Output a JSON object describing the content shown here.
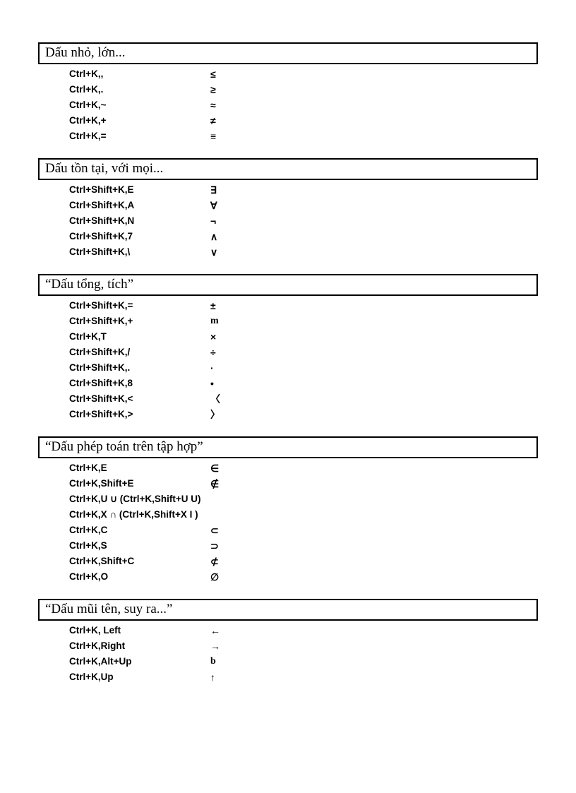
{
  "sections": [
    {
      "title": "Dấu nhỏ, lớn...",
      "rows": [
        {
          "shortcut": "Ctrl+K,,",
          "symbol": "≤"
        },
        {
          "shortcut": "Ctrl+K,.",
          "symbol": "≥"
        },
        {
          "shortcut": "Ctrl+K,~",
          "symbol": "≈"
        },
        {
          "shortcut": "Ctrl+K,+",
          "symbol": "≠"
        },
        {
          "shortcut": "Ctrl+K,=",
          "symbol": "≡"
        }
      ]
    },
    {
      "title": "Dấu tồn tại, với mọi...",
      "rows": [
        {
          "shortcut": "Ctrl+Shift+K,E",
          "symbol": "∃"
        },
        {
          "shortcut": "Ctrl+Shift+K,A",
          "symbol": "∀"
        },
        {
          "shortcut": "Ctrl+Shift+K,N",
          "symbol": "¬"
        },
        {
          "shortcut": "Ctrl+Shift+K,7",
          "symbol": "∧"
        },
        {
          "shortcut": "Ctrl+Shift+K,\\",
          "symbol": "∨"
        }
      ]
    },
    {
      "title": "“Dấu tổng, tích”",
      "rows": [
        {
          "shortcut": "Ctrl+Shift+K,=",
          "symbol": "±"
        },
        {
          "shortcut": "Ctrl+Shift+K,+",
          "symbol": "m",
          "symClass": "sym-serif"
        },
        {
          "shortcut": "Ctrl+K,T",
          "symbol": "×"
        },
        {
          "shortcut": "Ctrl+Shift+K,/",
          "symbol": "÷"
        },
        {
          "shortcut": "Ctrl+Shift+K,.",
          "symbol": "·"
        },
        {
          "shortcut": "Ctrl+Shift+K,8",
          "symbol": "•"
        },
        {
          "shortcut": "Ctrl+Shift+K,<",
          "symbol": "〈"
        },
        {
          "shortcut": "Ctrl+Shift+K,>",
          "symbol": "〉"
        }
      ]
    },
    {
      "title": "“Dấu phép toán trên tập hợp”",
      "rows": [
        {
          "shortcut": "Ctrl+K,E",
          "symbol": "∈"
        },
        {
          "shortcut": "Ctrl+K,Shift+E",
          "symbol": "∉"
        },
        {
          "merged": "Ctrl+K,U ∪ (Ctrl+K,Shift+U U)"
        },
        {
          "merged": "Ctrl+K,X ∩ (Ctrl+K,Shift+X Ι )"
        },
        {
          "shortcut": "Ctrl+K,C",
          "symbol": "⊂"
        },
        {
          "shortcut": "Ctrl+K,S",
          "symbol": "⊃"
        },
        {
          "shortcut": "Ctrl+K,Shift+C",
          "symbol": "⊄"
        },
        {
          "shortcut": "Ctrl+K,O",
          "symbol": "∅"
        }
      ]
    },
    {
      "title": "“Dấu mũi tên, suy ra...”",
      "rows": [
        {
          "shortcut": "Ctrl+K, Left",
          "symbol": "←"
        },
        {
          "shortcut": "Ctrl+K,Right",
          "symbol": "→"
        },
        {
          "shortcut": "Ctrl+K,Alt+Up",
          "symbol": "b",
          "symClass": "sym-serif"
        },
        {
          "shortcut": "Ctrl+K,Up",
          "symbol": "↑"
        }
      ]
    }
  ]
}
